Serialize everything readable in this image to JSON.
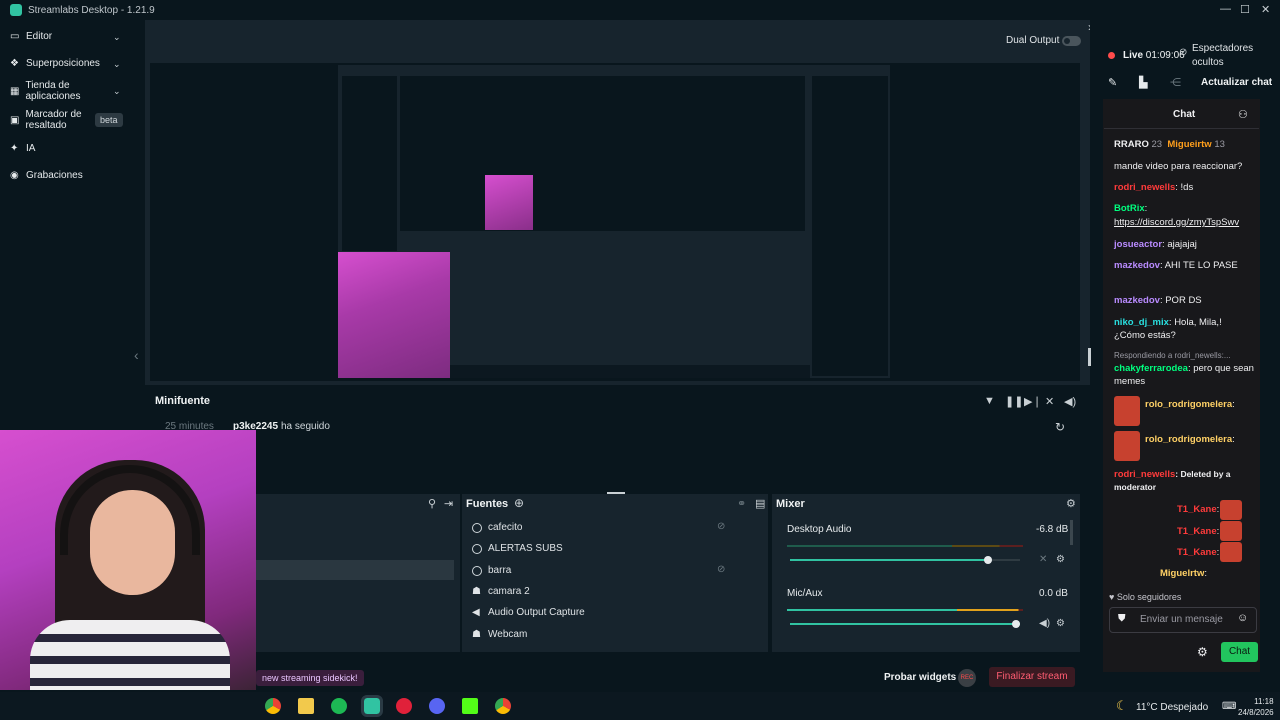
{
  "app": {
    "title": "Streamlabs Desktop - 1.21.9"
  },
  "sidebar": {
    "items": [
      {
        "label": "Editor"
      },
      {
        "label": "Superposiciones"
      },
      {
        "label": "Tienda de aplicaciones"
      },
      {
        "label": "Marcador de resaltado"
      },
      {
        "label": "IA"
      },
      {
        "label": "Grabaciones"
      }
    ],
    "beta_badge": "beta"
  },
  "editor": {
    "dual_output": "Dual Output"
  },
  "minifuente": {
    "title": "Minifuente",
    "event_time": "25 minutes",
    "event_user": "p3ke2245",
    "event_text": "ha seguido"
  },
  "sources": {
    "title": "Fuentes",
    "items": [
      "cafecito",
      "ALERTAS SUBS",
      "barra",
      "camara 2",
      "Audio Output Capture",
      "Webcam"
    ]
  },
  "mixer": {
    "title": "Mixer",
    "channels": [
      {
        "name": "Desktop Audio",
        "db": "-6.8 dB",
        "level": 0.86
      },
      {
        "name": "Mic/Aux",
        "db": "0.0 dB",
        "level": 1.0
      }
    ]
  },
  "footer": {
    "sidekick": "new streaming sidekick!",
    "probar": "Probar widgets",
    "rec": "REC",
    "finalizar": "Finalizar stream"
  },
  "chat_panel": {
    "live": "Live",
    "timer": "01:09:06",
    "viewers": "Espectadores ocultos",
    "actualizar": "Actualizar chat",
    "header": "Chat",
    "top_users": [
      {
        "name": "RRARO",
        "count": "23"
      },
      {
        "name": "Migueirtw",
        "count": "13"
      }
    ],
    "messages": [
      {
        "user": "",
        "text": "mande video para reaccionar?"
      },
      {
        "user": "rodri_newells",
        "text": ": !ds"
      },
      {
        "user": "BotRix",
        "text": ":"
      },
      {
        "user": "",
        "text": "https://discord.gg/zmyTspSwv"
      },
      {
        "user": "josueactor",
        "text": ": ajajajaj"
      },
      {
        "user": "mazkedov",
        "text": ": AHI TE LO PASE"
      },
      {
        "user": "mazkedov",
        "text": ": POR DS"
      },
      {
        "user": "niko_dj_mix",
        "text": ": Hola, Mila,! ¿Cómo estás?"
      },
      {
        "user": "",
        "text": "Respondiendo a rodri_newells:..."
      },
      {
        "user": "chakyferrarodea",
        "text": ": pero que sean memes"
      },
      {
        "user": "rolo_rodrigomelera",
        "text": ":"
      },
      {
        "user": "rolo_rodrigomelera",
        "text": ":"
      },
      {
        "user": "rodri_newells",
        "text": ": Deleted by a moderator"
      },
      {
        "user": "T1_Kane",
        "text": ":"
      },
      {
        "user": "T1_Kane",
        "text": ":"
      },
      {
        "user": "T1_Kane",
        "text": ":"
      },
      {
        "user": "Miguelrtw",
        "text": ":"
      }
    ],
    "solo": "Solo seguidores",
    "input_placeholder": "Enviar un mensaje",
    "send": "Chat"
  },
  "taskbar": {
    "weather": "11°C  Despejado",
    "time": "11:18",
    "date": "24/8/2026"
  }
}
